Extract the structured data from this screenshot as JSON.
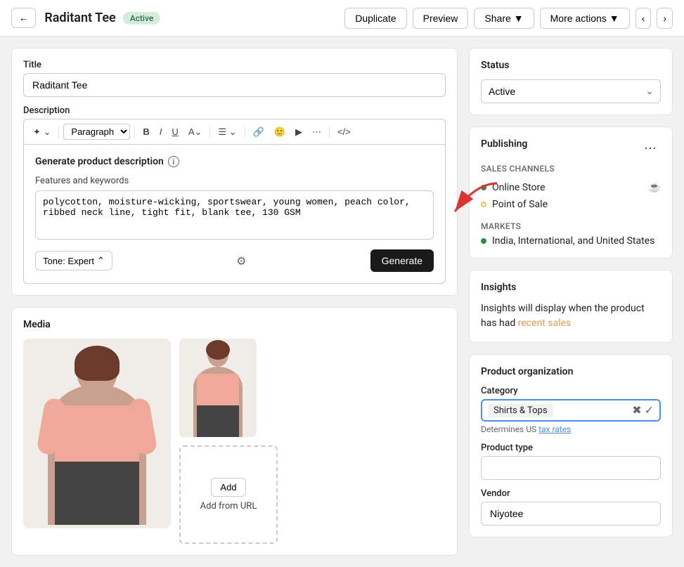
{
  "header": {
    "title": "Raditant Tee",
    "status_badge": "Active",
    "actions": {
      "duplicate": "Duplicate",
      "preview": "Preview",
      "share": "Share",
      "more_actions": "More actions"
    }
  },
  "title_section": {
    "label": "Title",
    "value": "Raditant Tee"
  },
  "description_section": {
    "label": "Description",
    "generate_title": "Generate product description",
    "features_label": "Features and keywords",
    "features_value": "polycotton, moisture-wicking, sportswear, young women, peach color, ribbed neck line, tight fit, blank tee, 130 GSM",
    "tone_label": "Tone: Expert",
    "generate_btn": "Generate",
    "paragraph_option": "Paragraph"
  },
  "media_section": {
    "title": "Media",
    "add_btn": "Add",
    "add_url_label": "Add from URL"
  },
  "right_panel": {
    "status": {
      "title": "Status",
      "value": "Active"
    },
    "publishing": {
      "title": "Publishing",
      "sales_channels_label": "Sales channels",
      "channels": [
        {
          "name": "Online Store",
          "status": "active"
        },
        {
          "name": "Point of Sale",
          "status": "inactive"
        }
      ],
      "markets_label": "Markets",
      "markets": [
        {
          "name": "India, International, and United States",
          "status": "active"
        }
      ]
    },
    "insights": {
      "title": "Insights",
      "text_part1": "Insights will display when the product has had",
      "link_text": "recent sales",
      "text_part2": ""
    },
    "organization": {
      "title": "Product organization",
      "category_label": "Category",
      "category_value": "Shirts & Tops",
      "tax_text": "Determines US",
      "tax_link": "tax rates",
      "product_type_label": "Product type",
      "product_type_value": "",
      "vendor_label": "Vendor",
      "vendor_value": "Niyotee"
    }
  }
}
